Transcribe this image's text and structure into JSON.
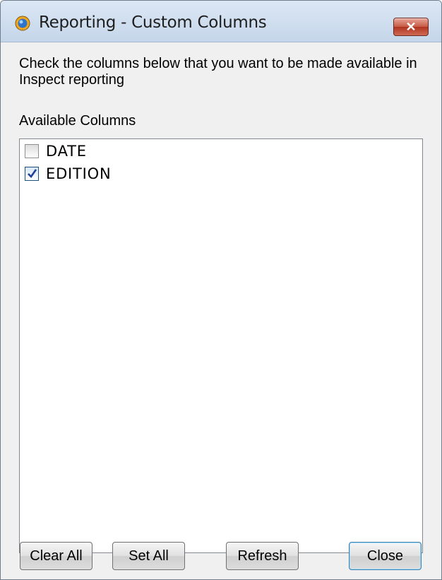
{
  "window": {
    "title": "Reporting - Custom Columns",
    "close_glyph": "✕"
  },
  "instructions": "Check the columns below that you want to be made available in Inspect reporting",
  "available_label": "Available Columns",
  "columns": [
    {
      "label": "DATE",
      "checked": false
    },
    {
      "label": "EDITION",
      "checked": true
    }
  ],
  "buttons": {
    "clear_all": "Clear All",
    "set_all": "Set All",
    "refresh": "Refresh",
    "close": "Close"
  },
  "colors": {
    "titlebar": "#c9d9ec",
    "close_button": "#c65a45",
    "check_mark": "#1f3f9a"
  }
}
